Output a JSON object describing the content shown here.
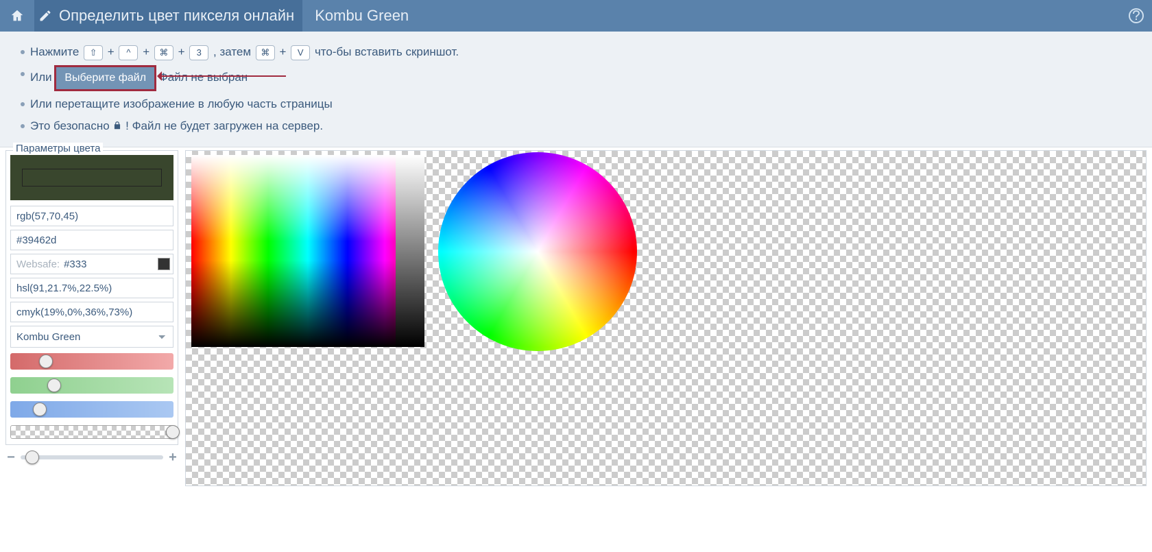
{
  "header": {
    "title": "Определить цвет пикселя онлайн",
    "color_name": "Kombu Green"
  },
  "instructions": {
    "line1_prefix": "Нажмите ",
    "key_shift": "⇧",
    "plus": "+",
    "key_ctrl": "^",
    "key_cmd": "⌘",
    "key_3": "3",
    "then": ", затем ",
    "key_cmd2": "⌘",
    "key_v": "V",
    "line1_suffix": " что-бы вставить скриншот.",
    "line2_prefix": "Или ",
    "choose_file": "Выберите файл",
    "no_file": " Файл не выбран",
    "line3": "Или перетащите изображение в любую часть страницы",
    "line4_a": "Это безопасно ",
    "line4_b": "! Файл не будет загружен на сервер."
  },
  "panel": {
    "legend": "Параметры цвета",
    "swatch": "#39462d",
    "rgb": "rgb(57,70,45)",
    "hex": "#39462d",
    "websafe_label": "Websafe:",
    "websafe": "#333",
    "hsl": "hsl(91,21.7%,22.5%)",
    "cmyk": "cmyk(19%,0%,36%,73%)",
    "name": "Kombu Green",
    "slider_r": 22,
    "slider_g": 27,
    "slider_b": 18,
    "slider_a": 100,
    "zoom": 8
  }
}
